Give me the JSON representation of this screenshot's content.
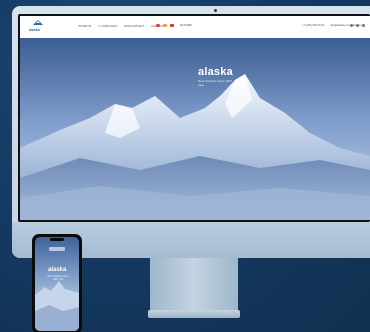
{
  "site": {
    "logo_text": "alaska",
    "menu": [
      "ПРОЕКТЫ",
      "О КОМПАНИИ",
      "ФРАНЧАЙЗИНГ",
      "КОНТАКТЫ"
    ],
    "shop_label": "МАГАЗИН",
    "phone": "+7 (000) 000-00-00",
    "email": "info@alaska-mountain.com",
    "hero_brand": "alaska",
    "hero_tagline": "New Horizons since 2007 year"
  },
  "colors": {
    "background": "#14385f",
    "monitor": "#c5d4e2",
    "accent": "#2a6aa8"
  },
  "icons": [
    "logo-icon",
    "flag-icon",
    "social-icon",
    "camera-icon"
  ]
}
